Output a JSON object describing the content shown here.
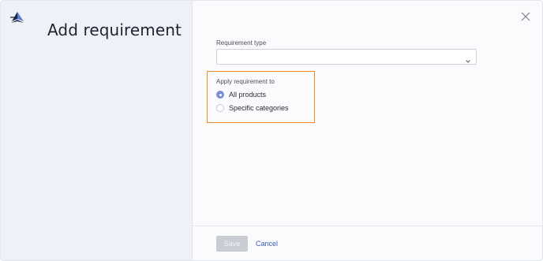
{
  "header": {
    "title": "Add requirement",
    "logo_icon": "compass-logo-icon"
  },
  "form": {
    "requirement_type": {
      "label": "Requirement type",
      "value": "",
      "chevron_icon": "chevron-down-icon"
    },
    "apply_to": {
      "label": "Apply requirement to",
      "options": [
        {
          "label": "All products",
          "checked": true
        },
        {
          "label": "Specific categories",
          "checked": false
        }
      ]
    }
  },
  "footer": {
    "save_label": "Save",
    "cancel_label": "Cancel"
  },
  "colors": {
    "highlight": "#f08a24",
    "radio_checked": "#7b8ed6",
    "link": "#3d5ab8",
    "left_panel_bg": "#eef1f8"
  }
}
